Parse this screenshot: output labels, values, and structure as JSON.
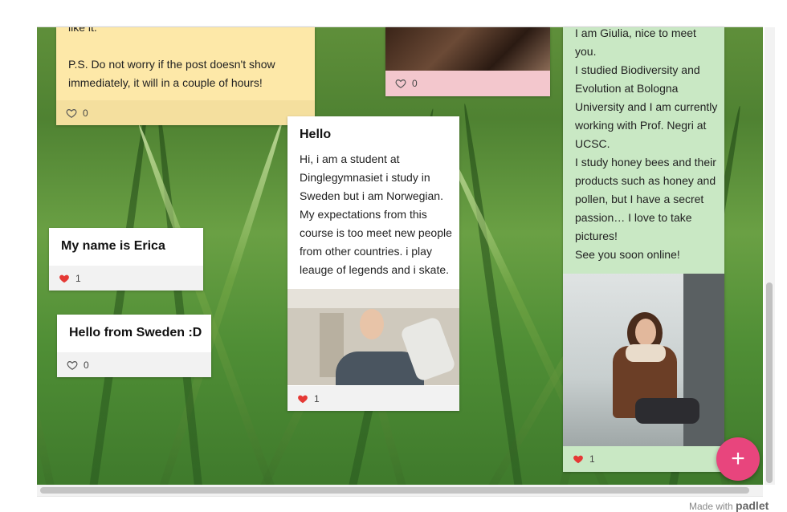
{
  "cards": {
    "instructions": {
      "body_lines": [
        "like it.",
        "",
        "P.S. Do not worry if the post doesn't show",
        "immediately, it will in a couple of hours!"
      ],
      "likes": "0",
      "bg": "#fde8a8",
      "bar_bg": "#f4df9e"
    },
    "photo_pink": {
      "likes": "0",
      "bg": "#f3c7cd"
    },
    "hello": {
      "title": "Hello",
      "body_lines": [
        "Hi, i am a student at",
        "Dinglegymnasiet i study in",
        "Sweden but i am Norwegian.",
        "My expectations from this",
        "course is too meet new people",
        "from other countries. i play",
        "leauge of legends and i skate."
      ],
      "likes": "1"
    },
    "giulia": {
      "body_lines": [
        "I am Giulia, nice to meet",
        "you.",
        "I studied Biodiversity and",
        "Evolution at Bologna",
        "University and I am currently",
        "working with Prof. Negri at",
        "UCSC.",
        "I study honey bees and their",
        "products such as honey and",
        "pollen, but I have a secret",
        "passion… I love to take",
        "pictures!",
        "See you soon online!"
      ],
      "likes": "1",
      "bg": "#c9e8c4"
    },
    "erica": {
      "title": "My name is Erica",
      "likes": "1"
    },
    "sweden": {
      "title": "Hello from Sweden :D",
      "likes": "0"
    }
  },
  "footer": {
    "made_with": "Made with",
    "brand": "padlet"
  },
  "colors": {
    "heart_filled": "#e53935",
    "fab": "#e8457d"
  }
}
